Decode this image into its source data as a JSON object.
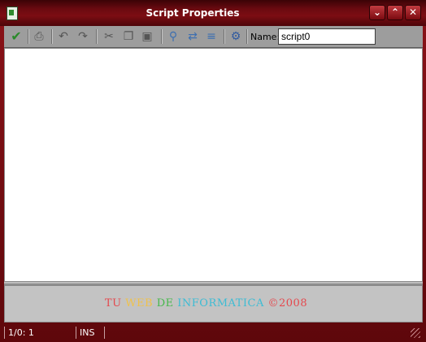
{
  "window": {
    "title": "Script Properties"
  },
  "title_buttons": {
    "minimize": "⌄",
    "maximize": "⌃",
    "close": "✕"
  },
  "toolbar": {
    "name_label": "Name:",
    "name_value": "script0",
    "items": [
      {
        "icon": "checkmark-icon",
        "glyph": "✔"
      },
      {
        "icon": "printer-icon",
        "glyph": "⎙"
      },
      {
        "icon": "undo-icon",
        "glyph": "↶"
      },
      {
        "icon": "redo-icon",
        "glyph": "↷"
      },
      {
        "icon": "cut-icon",
        "glyph": "✂"
      },
      {
        "icon": "copy-icon",
        "glyph": "❐"
      },
      {
        "icon": "paste-icon",
        "glyph": "▣"
      },
      {
        "icon": "find-icon",
        "glyph": "⚲"
      },
      {
        "icon": "replace-icon",
        "glyph": "⇄"
      },
      {
        "icon": "goto-line-icon",
        "glyph": "≡"
      },
      {
        "icon": "properties-icon",
        "glyph": "⚙"
      }
    ]
  },
  "footer": {
    "watermark": [
      {
        "text": "TU ",
        "color": "#e5484d"
      },
      {
        "text": "WEB ",
        "color": "#f0c24a"
      },
      {
        "text": "DE ",
        "color": "#46b84b"
      },
      {
        "text": "INFORMATICA",
        "color": "#3dbcd4"
      },
      {
        "text": " ©2008",
        "color": "#e5484d"
      }
    ]
  },
  "status": {
    "position": "1/0:  1",
    "mode": "INS"
  }
}
